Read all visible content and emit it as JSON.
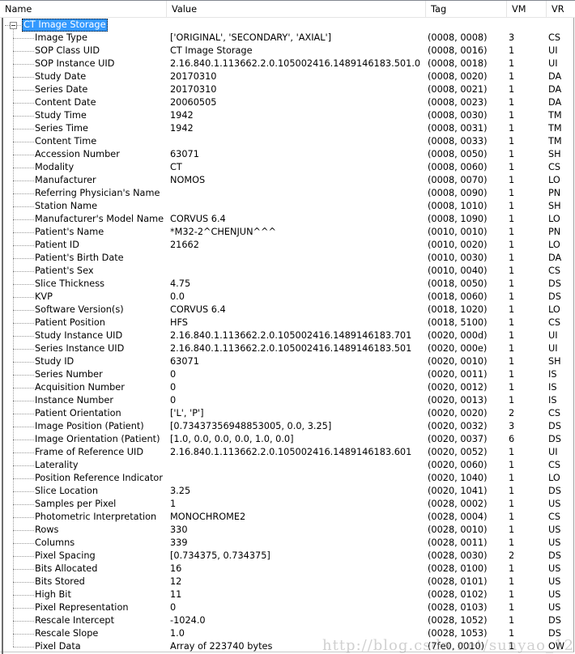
{
  "header": {
    "columns": [
      "Name",
      "Value",
      "Tag",
      "VM",
      "VR"
    ]
  },
  "tree": {
    "root": {
      "label": "CT Image Storage",
      "expanded": true,
      "selected": true,
      "expander_icon": "minus-box-icon"
    },
    "rows": [
      {
        "name": "Image Type",
        "value": "['ORIGINAL', 'SECONDARY', 'AXIAL']",
        "tag": "(0008, 0008)",
        "vm": "3",
        "vr": "CS"
      },
      {
        "name": "SOP Class UID",
        "value": "CT Image Storage",
        "tag": "(0008, 0016)",
        "vm": "1",
        "vr": "UI"
      },
      {
        "name": "SOP Instance UID",
        "value": "2.16.840.1.113662.2.0.105002416.1489146183.501.0",
        "tag": "(0008, 0018)",
        "vm": "1",
        "vr": "UI"
      },
      {
        "name": "Study Date",
        "value": "20170310",
        "tag": "(0008, 0020)",
        "vm": "1",
        "vr": "DA"
      },
      {
        "name": "Series Date",
        "value": "20170310",
        "tag": "(0008, 0021)",
        "vm": "1",
        "vr": "DA"
      },
      {
        "name": "Content Date",
        "value": "20060505",
        "tag": "(0008, 0023)",
        "vm": "1",
        "vr": "DA"
      },
      {
        "name": "Study Time",
        "value": "1942",
        "tag": "(0008, 0030)",
        "vm": "1",
        "vr": "TM"
      },
      {
        "name": "Series Time",
        "value": "1942",
        "tag": "(0008, 0031)",
        "vm": "1",
        "vr": "TM"
      },
      {
        "name": "Content Time",
        "value": "",
        "tag": "(0008, 0033)",
        "vm": "1",
        "vr": "TM"
      },
      {
        "name": "Accession Number",
        "value": "63071",
        "tag": "(0008, 0050)",
        "vm": "1",
        "vr": "SH"
      },
      {
        "name": "Modality",
        "value": "CT",
        "tag": "(0008, 0060)",
        "vm": "1",
        "vr": "CS"
      },
      {
        "name": "Manufacturer",
        "value": "NOMOS",
        "tag": "(0008, 0070)",
        "vm": "1",
        "vr": "LO"
      },
      {
        "name": "Referring Physician's Name",
        "value": "",
        "tag": "(0008, 0090)",
        "vm": "1",
        "vr": "PN"
      },
      {
        "name": "Station Name",
        "value": "",
        "tag": "(0008, 1010)",
        "vm": "1",
        "vr": "SH"
      },
      {
        "name": "Manufacturer's Model Name",
        "value": "CORVUS 6.4",
        "tag": "(0008, 1090)",
        "vm": "1",
        "vr": "LO"
      },
      {
        "name": "Patient's Name",
        "value": "*M32-2^CHENJUN^^^",
        "tag": "(0010, 0010)",
        "vm": "1",
        "vr": "PN"
      },
      {
        "name": "Patient ID",
        "value": "21662",
        "tag": "(0010, 0020)",
        "vm": "1",
        "vr": "LO"
      },
      {
        "name": "Patient's Birth Date",
        "value": "",
        "tag": "(0010, 0030)",
        "vm": "1",
        "vr": "DA"
      },
      {
        "name": "Patient's Sex",
        "value": "",
        "tag": "(0010, 0040)",
        "vm": "1",
        "vr": "CS"
      },
      {
        "name": "Slice Thickness",
        "value": "4.75",
        "tag": "(0018, 0050)",
        "vm": "1",
        "vr": "DS"
      },
      {
        "name": "KVP",
        "value": "0.0",
        "tag": "(0018, 0060)",
        "vm": "1",
        "vr": "DS"
      },
      {
        "name": "Software Version(s)",
        "value": "CORVUS 6.4",
        "tag": "(0018, 1020)",
        "vm": "1",
        "vr": "LO"
      },
      {
        "name": "Patient Position",
        "value": "HFS",
        "tag": "(0018, 5100)",
        "vm": "1",
        "vr": "CS"
      },
      {
        "name": "Study Instance UID",
        "value": "2.16.840.1.113662.2.0.105002416.1489146183.701",
        "tag": "(0020, 000d)",
        "vm": "1",
        "vr": "UI"
      },
      {
        "name": "Series Instance UID",
        "value": "2.16.840.1.113662.2.0.105002416.1489146183.501",
        "tag": "(0020, 000e)",
        "vm": "1",
        "vr": "UI"
      },
      {
        "name": "Study ID",
        "value": "63071",
        "tag": "(0020, 0010)",
        "vm": "1",
        "vr": "SH"
      },
      {
        "name": "Series Number",
        "value": "0",
        "tag": "(0020, 0011)",
        "vm": "1",
        "vr": "IS"
      },
      {
        "name": "Acquisition Number",
        "value": "0",
        "tag": "(0020, 0012)",
        "vm": "1",
        "vr": "IS"
      },
      {
        "name": "Instance Number",
        "value": "0",
        "tag": "(0020, 0013)",
        "vm": "1",
        "vr": "IS"
      },
      {
        "name": "Patient Orientation",
        "value": "['L', 'P']",
        "tag": "(0020, 0020)",
        "vm": "2",
        "vr": "CS"
      },
      {
        "name": "Image Position (Patient)",
        "value": "[0.73437356948853005, 0.0, 3.25]",
        "tag": "(0020, 0032)",
        "vm": "3",
        "vr": "DS"
      },
      {
        "name": "Image Orientation (Patient)",
        "value": "[1.0, 0.0, 0.0, 0.0, 1.0, 0.0]",
        "tag": "(0020, 0037)",
        "vm": "6",
        "vr": "DS"
      },
      {
        "name": "Frame of Reference UID",
        "value": "2.16.840.1.113662.2.0.105002416.1489146183.601",
        "tag": "(0020, 0052)",
        "vm": "1",
        "vr": "UI"
      },
      {
        "name": "Laterality",
        "value": "",
        "tag": "(0020, 0060)",
        "vm": "1",
        "vr": "CS"
      },
      {
        "name": "Position Reference Indicator",
        "value": "",
        "tag": "(0020, 1040)",
        "vm": "1",
        "vr": "LO"
      },
      {
        "name": "Slice Location",
        "value": "3.25",
        "tag": "(0020, 1041)",
        "vm": "1",
        "vr": "DS"
      },
      {
        "name": "Samples per Pixel",
        "value": "1",
        "tag": "(0028, 0002)",
        "vm": "1",
        "vr": "US"
      },
      {
        "name": "Photometric Interpretation",
        "value": "MONOCHROME2",
        "tag": "(0028, 0004)",
        "vm": "1",
        "vr": "CS"
      },
      {
        "name": "Rows",
        "value": "330",
        "tag": "(0028, 0010)",
        "vm": "1",
        "vr": "US"
      },
      {
        "name": "Columns",
        "value": "339",
        "tag": "(0028, 0011)",
        "vm": "1",
        "vr": "US"
      },
      {
        "name": "Pixel Spacing",
        "value": "[0.734375, 0.734375]",
        "tag": "(0028, 0030)",
        "vm": "2",
        "vr": "DS"
      },
      {
        "name": "Bits Allocated",
        "value": "16",
        "tag": "(0028, 0100)",
        "vm": "1",
        "vr": "US"
      },
      {
        "name": "Bits Stored",
        "value": "12",
        "tag": "(0028, 0101)",
        "vm": "1",
        "vr": "US"
      },
      {
        "name": "High Bit",
        "value": "11",
        "tag": "(0028, 0102)",
        "vm": "1",
        "vr": "US"
      },
      {
        "name": "Pixel Representation",
        "value": "0",
        "tag": "(0028, 0103)",
        "vm": "1",
        "vr": "US"
      },
      {
        "name": "Rescale Intercept",
        "value": "-1024.0",
        "tag": "(0028, 1052)",
        "vm": "1",
        "vr": "DS"
      },
      {
        "name": "Rescale Slope",
        "value": "1.0",
        "tag": "(0028, 1053)",
        "vm": "1",
        "vr": "DS"
      },
      {
        "name": "Pixel Data",
        "value": "Array of 223740 bytes",
        "tag": "(7fe0, 0010)",
        "vm": "1",
        "vr": "OW"
      }
    ]
  },
  "watermark": "http://blog.csdn.net/sunyao_123",
  "colors": {
    "selection": "#3399ff",
    "selection_text": "#ffffff",
    "tree_lines": "#9a9a9a"
  }
}
